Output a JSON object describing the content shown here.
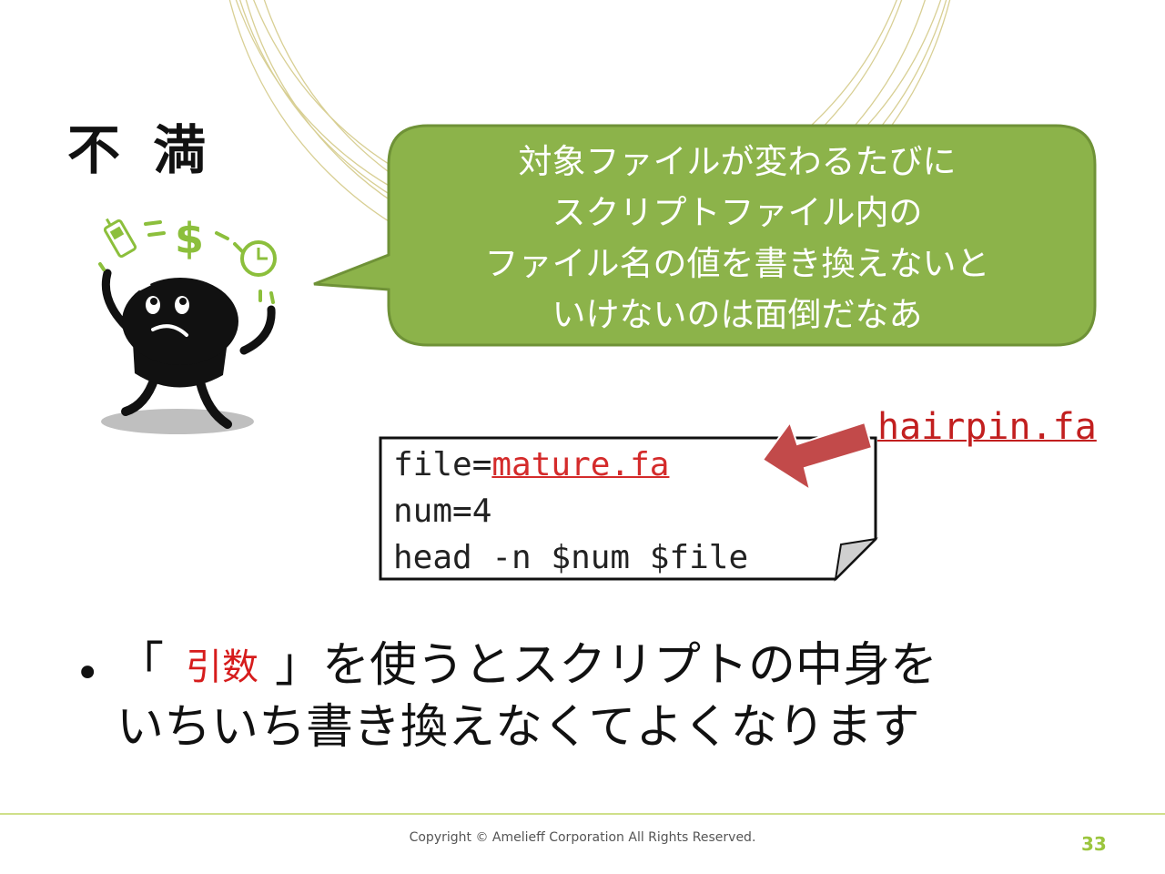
{
  "slide": {
    "title": "不 満",
    "bubble": {
      "lines": [
        "対象ファイルが変わるたびに",
        "スクリプトファイル内の",
        "ファイル名の値を書き換えないと",
        "いけないのは面倒だなあ"
      ]
    },
    "code": {
      "line1_prefix": "file=",
      "line1_value": "mature.fa",
      "line2": "num=4",
      "line3": "head -n $num $file"
    },
    "replacement": "hairpin.fa",
    "bullet": {
      "marker": "•",
      "open": "「",
      "keyword": "引数",
      "rest": "」を使うとスクリプトの中身を",
      "line2": "いちいち書き換えなくてよくなります"
    },
    "footer": {
      "copyright": "Copyright © Amelieff Corporation All Rights Reserved.",
      "page": "33"
    }
  },
  "colors": {
    "bubble": "#8cb34a",
    "accent_green": "#9bc53d",
    "arrow": "#c24a4a",
    "link_red": "#d42b2b"
  },
  "icons": [
    "worried-character-illustration",
    "phone-icon",
    "dollar-icon",
    "clock-icon",
    "arrow-icon"
  ]
}
